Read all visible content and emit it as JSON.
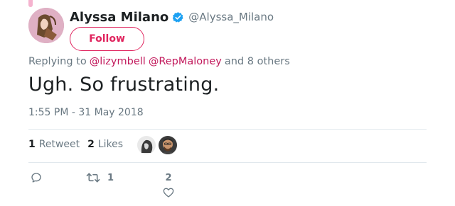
{
  "tweet": {
    "author": {
      "display_name": "Alyssa Milano",
      "handle": "@Alyssa_Milano",
      "verified": true,
      "avatar_icon": "profile-avatar"
    },
    "follow_label": "Follow",
    "reply_prefix": "Replying to",
    "reply_mentions": [
      "@lizymbell",
      "@RepMaloney"
    ],
    "reply_suffix": "and 8 others",
    "text": "Ugh. So frustrating.",
    "timestamp": "1:55 PM - 31 May 2018",
    "stats": {
      "retweets_count": "1",
      "retweets_label": "Retweet",
      "likes_count": "2",
      "likes_label": "Likes"
    },
    "actions": {
      "reply_icon": "reply-icon",
      "retweet_icon": "retweet-icon",
      "retweet_count": "1",
      "like_icon": "heart-icon",
      "like_count": "2"
    }
  },
  "colors": {
    "accent": "#e0245e",
    "mention": "#c2185b",
    "verified": "#1da1f2",
    "secondary_text": "#697882",
    "divider": "#e1e8ed"
  }
}
